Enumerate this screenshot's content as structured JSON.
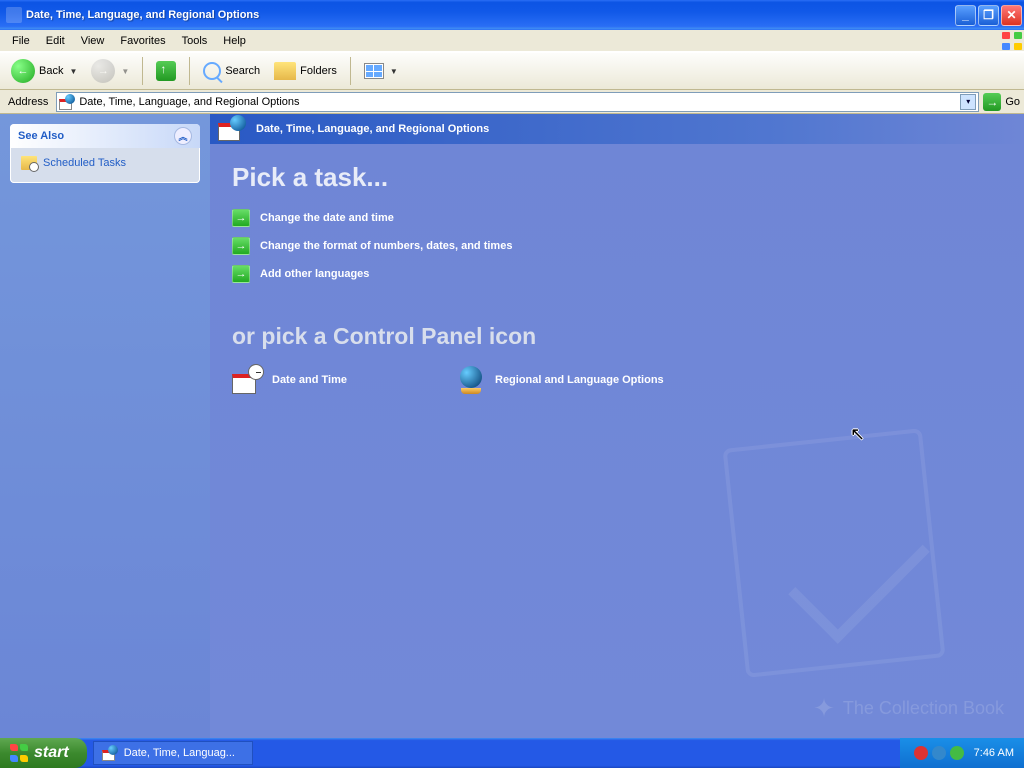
{
  "window": {
    "title": "Date, Time, Language, and Regional Options"
  },
  "menu": {
    "file": "File",
    "edit": "Edit",
    "view": "View",
    "favorites": "Favorites",
    "tools": "Tools",
    "help": "Help"
  },
  "toolbar": {
    "back": "Back",
    "search": "Search",
    "folders": "Folders"
  },
  "address": {
    "label": "Address",
    "value": "Date, Time, Language, and Regional Options",
    "go": "Go"
  },
  "sidepanel": {
    "see_also": "See Also",
    "scheduled_tasks": "Scheduled Tasks"
  },
  "main": {
    "header": "Date, Time, Language, and Regional Options",
    "pick_task": "Pick a task...",
    "task_change_date": "Change the date and time",
    "task_change_format": "Change the format of numbers, dates, and times",
    "task_add_lang": "Add other languages",
    "or_pick": "or pick a Control Panel icon",
    "icon_datetime": "Date and Time",
    "icon_regional": "Regional and Language Options"
  },
  "taskbar": {
    "start": "start",
    "app": "Date, Time, Languag...",
    "clock": "7:46 AM"
  },
  "watermark": "The Collection Book"
}
